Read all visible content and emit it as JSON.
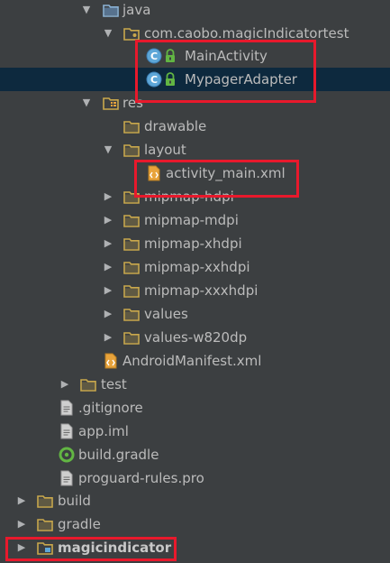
{
  "tree": {
    "java": "java",
    "package": "com.caobo.magicIndicatortest",
    "main_activity": "MainActivity",
    "mypager_adapter": "MypagerAdapter",
    "res": "res",
    "drawable": "drawable",
    "layout": "layout",
    "activity_main": "activity_main.xml",
    "mipmap_hdpi": "mipmap-hdpi",
    "mipmap_mdpi": "mipmap-mdpi",
    "mipmap_xhdpi": "mipmap-xhdpi",
    "mipmap_xxhdpi": "mipmap-xxhdpi",
    "mipmap_xxxhdpi": "mipmap-xxxhdpi",
    "values": "values",
    "values_w820dp": "values-w820dp",
    "manifest": "AndroidManifest.xml",
    "test": "test",
    "gitignore": ".gitignore",
    "app_iml": "app.iml",
    "build_gradle": "build.gradle",
    "proguard": "proguard-rules.pro",
    "build": "build",
    "gradle": "gradle",
    "magicindicator": "magicindicator"
  },
  "icons": {
    "folder": "folder-icon",
    "source_folder": "source-folder-icon",
    "resource_folder": "resource-folder-icon",
    "class": "class-icon",
    "lock": "lock-icon",
    "xml": "xml-file-icon",
    "file": "file-icon",
    "gradle": "gradle-icon",
    "module": "module-icon"
  },
  "colors": {
    "background": "#3c3f41",
    "selection": "#0d293e",
    "text": "#bbbbbb",
    "folder": "#c9a84c",
    "class_icon": "#5ea7d8",
    "lock": "#62b543",
    "highlight_box": "#e8192c"
  }
}
